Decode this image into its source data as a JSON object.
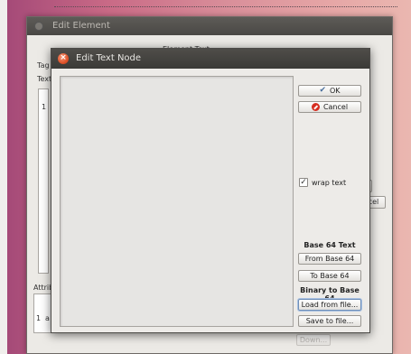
{
  "background_window": {
    "title": "Edit Element",
    "element_text_label": "Element Text",
    "tag_label": "Tag",
    "text_label": "Text",
    "row_number": "1",
    "attributes_label": "Attrib",
    "attr_row_number": "1",
    "attr_row_value": "a",
    "side_button_1": "c",
    "side_button_2": "cel",
    "down_button": "Down..."
  },
  "dialog": {
    "title": "Edit Text Node",
    "text_content": "",
    "ok_label": "OK",
    "cancel_label": "Cancel",
    "wrap_text_label": "wrap text",
    "wrap_text_checked": true,
    "base64_text_heading": "Base 64 Text",
    "from_base64_label": "From Base 64",
    "to_base64_label": "To Base 64",
    "binary_heading": "Binary to Base 64",
    "load_from_file_label": "Load from file...",
    "save_to_file_label": "Save to file..."
  }
}
